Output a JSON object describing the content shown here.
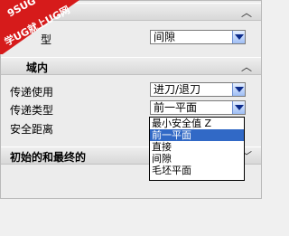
{
  "watermark": {
    "line1": "9SUG",
    "line2": "学UG就上UG网"
  },
  "sections": {
    "first": {
      "chevron": "︿"
    },
    "second": {
      "title": "域内",
      "chevron": "︿"
    },
    "third": {
      "title": "初始的和最终的",
      "chevron": "﹀"
    }
  },
  "rows": {
    "row0": {
      "label": "型",
      "value": "间隙"
    },
    "row1": {
      "label": "传递使用",
      "value": "进刀/退刀"
    },
    "row2": {
      "label": "传递类型",
      "value": "前一平面"
    },
    "row3": {
      "label": "安全距离"
    }
  },
  "dropdown": {
    "options": [
      "最小安全值 Z",
      "前一平面",
      "直接",
      "间隙",
      "毛坯平面"
    ],
    "selected": "前一平面"
  }
}
